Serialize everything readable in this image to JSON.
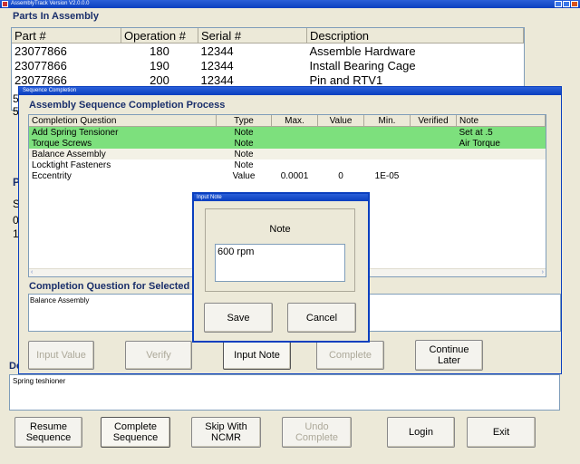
{
  "window": {
    "title": "AssemblyTrack  Version V2.0.0.0"
  },
  "parts": {
    "title": "Parts In Assembly",
    "columns": [
      "Part #",
      "Operation #",
      "Serial #",
      "Description"
    ],
    "rows": [
      {
        "part": "23077866",
        "op": "180",
        "serial": "12344",
        "desc": "Assemble Hardware"
      },
      {
        "part": "23077866",
        "op": "190",
        "serial": "12344",
        "desc": "Install Bearing Cage"
      },
      {
        "part": "23077866",
        "op": "200",
        "serial": "12344",
        "desc": "Pin and RTV1"
      }
    ]
  },
  "partial_left_labels": [
    "5",
    "5",
    "P",
    "S",
    "0",
    "1",
    "De"
  ],
  "description_box": {
    "text": "Spring teshioner"
  },
  "sequence": {
    "window_title": "Sequence Completion",
    "title": "Assembly Sequence Completion Process",
    "columns": [
      "Completion Question",
      "Type",
      "Max.",
      "Value",
      "Min.",
      "Verified",
      "Note"
    ],
    "rows": [
      {
        "question": "Add Spring Tensioner",
        "type": "Note",
        "max": "",
        "value": "",
        "min": "",
        "verified": "",
        "note": "Set at .5",
        "highlight": true
      },
      {
        "question": "Torque Screws",
        "type": "Note",
        "max": "",
        "value": "",
        "min": "",
        "verified": "",
        "note": "Air Torque",
        "highlight": true
      },
      {
        "question": "Balance Assembly",
        "type": "Note",
        "max": "",
        "value": "",
        "min": "",
        "verified": "",
        "note": "",
        "highlight": false
      },
      {
        "question": "Locktight Fasteners",
        "type": "Note",
        "max": "",
        "value": "",
        "min": "",
        "verified": "",
        "note": "",
        "highlight": false
      },
      {
        "question": "Eccentrity",
        "type": "Value",
        "max": "0.0001",
        "value": "0",
        "min": "1E-05",
        "verified": "",
        "note": "",
        "highlight": false
      }
    ],
    "selected_label": "Completion Question  for Selected C",
    "selected_text": "Balance Assembly",
    "buttons": {
      "input_value": "Input Value",
      "verify": "Verify",
      "input_note": "Input Note",
      "complete": "Complete",
      "continue_later": "Continue Later"
    }
  },
  "modal": {
    "window_title": "Input Note",
    "label": "Note",
    "value": "600 rpm",
    "save": "Save",
    "cancel": "Cancel"
  },
  "bottom_buttons": {
    "resume": "Resume Sequence",
    "complete_seq": "Complete Sequence",
    "skip": "Skip With NCMR",
    "undo": "Undo Complete",
    "login": "Login",
    "exit": "Exit"
  },
  "colors": {
    "highlight": "#7de07d",
    "section_title": "#1a2f6b",
    "titlebar": "#0a3fbf"
  }
}
